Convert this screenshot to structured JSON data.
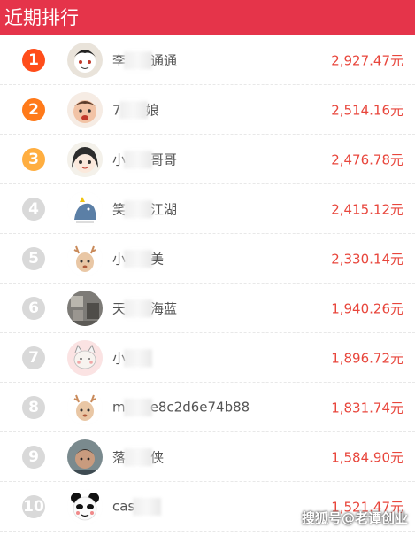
{
  "header": {
    "title": "近期排行"
  },
  "colors": {
    "header_bg": "#e5344a",
    "amount": "#e8463c",
    "rank1": "#ff4d1a",
    "rank2": "#ff7a1a",
    "rank3": "#ffae40",
    "rank_other": "#d9d9d9"
  },
  "rows": [
    {
      "rank": "1",
      "name_pre": "李",
      "name_post": "通通",
      "amount": "2,927.47元",
      "avatar": "cartoon-face-avatar"
    },
    {
      "rank": "2",
      "name_pre": "7",
      "name_post": "娘",
      "amount": "2,514.16元",
      "avatar": "baby-photo-avatar"
    },
    {
      "rank": "3",
      "name_pre": "小",
      "name_post": "哥哥",
      "amount": "2,476.78元",
      "avatar": "anime-girl-avatar"
    },
    {
      "rank": "4",
      "name_pre": "笑",
      "name_post": "江湖",
      "amount": "2,415.12元",
      "avatar": "dinosaur-avatar"
    },
    {
      "rank": "5",
      "name_pre": "小",
      "name_post": "美",
      "amount": "2,330.14元",
      "avatar": "deer-cartoon-avatar"
    },
    {
      "rank": "6",
      "name_pre": "天",
      "name_post": "海蓝",
      "amount": "1,940.26元",
      "avatar": "room-photo-avatar"
    },
    {
      "rank": "7",
      "name_pre": "小",
      "name_post": "",
      "amount": "1,896.72元",
      "avatar": "cat-cartoon-avatar"
    },
    {
      "rank": "8",
      "name_pre": "m",
      "name_post": "e8c2d6e74b88",
      "amount": "1,831.74元",
      "avatar": "deer-cartoon-avatar"
    },
    {
      "rank": "9",
      "name_pre": "落",
      "name_post": "侠",
      "amount": "1,584.90元",
      "avatar": "man-photo-avatar"
    },
    {
      "rank": "10",
      "name_pre": "cas",
      "name_post": "",
      "amount": "1,521.47元",
      "avatar": "panda-meme-avatar"
    }
  ],
  "watermark": "搜狐号@老谭创业"
}
